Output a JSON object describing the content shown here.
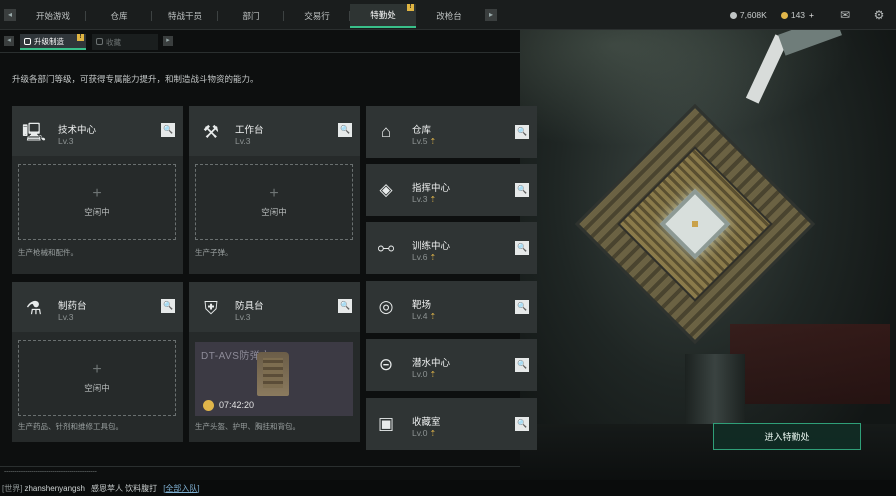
{
  "nav": {
    "tabs": [
      {
        "label": "开始游戏",
        "active": false,
        "badge": ""
      },
      {
        "label": "仓库",
        "active": false,
        "badge": ""
      },
      {
        "label": "特战干员",
        "active": false,
        "badge": ""
      },
      {
        "label": "部门",
        "active": false,
        "badge": ""
      },
      {
        "label": "交易行",
        "active": false,
        "badge": ""
      },
      {
        "label": "特勤处",
        "active": true,
        "badge": "!"
      },
      {
        "label": "改枪台",
        "active": false,
        "badge": ""
      }
    ],
    "left_arrow": "◂",
    "right_arrow": "▸"
  },
  "currency": {
    "silver": "7,608K",
    "gold": "143",
    "plus": "+"
  },
  "subtabs": {
    "active_label": "升级制造",
    "active_badge": "!",
    "inactive_label": "收藏",
    "left_arrow": "◂",
    "right_arrow": "▸"
  },
  "description": "升级各部门等级，可获得专属能力提升，和制造战斗物资的能力。",
  "large_cards": [
    {
      "name": "技术中心",
      "level": "Lv.3",
      "status": "空闲中",
      "desc": "生产枪械和配件。",
      "icon": "monitor-icon",
      "glyph": "🖳"
    },
    {
      "name": "工作台",
      "level": "Lv.3",
      "status": "空闲中",
      "desc": "生产子弹。",
      "icon": "tools-icon",
      "glyph": "⚒"
    },
    {
      "name": "制药台",
      "level": "Lv.3",
      "status": "空闲中",
      "desc": "生产药品、针剂和维修工具包。",
      "icon": "microscope-icon",
      "glyph": "⚗"
    },
    {
      "name": "防具台",
      "level": "Lv.3",
      "status": "",
      "desc": "生产头盔、护甲、胸挂和背包。",
      "icon": "armor-icon",
      "glyph": "⛨"
    }
  ],
  "crafting": {
    "item_name": "DT-AVS防弹衣",
    "timer": "07:42:20"
  },
  "small_cards": [
    {
      "name": "仓库",
      "level": "Lv.5",
      "icon": "warehouse-icon",
      "glyph": "⌂",
      "up": "⇡"
    },
    {
      "name": "指挥中心",
      "level": "Lv.3",
      "icon": "command-icon",
      "glyph": "◈",
      "up": "⇡"
    },
    {
      "name": "训练中心",
      "level": "Lv.6",
      "icon": "dumbbell-icon",
      "glyph": "⧟",
      "up": "⇡"
    },
    {
      "name": "靶场",
      "level": "Lv.4",
      "icon": "target-icon",
      "glyph": "◎",
      "up": "⇡"
    },
    {
      "name": "潜水中心",
      "level": "Lv.0",
      "icon": "diving-mask-icon",
      "glyph": "⊝",
      "up": "⇡"
    },
    {
      "name": "收藏室",
      "level": "Lv.0",
      "icon": "collection-icon",
      "glyph": "▣",
      "up": "⇡"
    }
  ],
  "enter_button": "进入特勤处",
  "chat": {
    "channel": "[世界]",
    "user": "zhanshenyangsh",
    "message": "感恩苹人 饮料腹打",
    "link": "[全部入队]"
  },
  "colors": {
    "accent": "#39c08a",
    "badge": "#e0b542",
    "level_up": "#e0b54a"
  }
}
